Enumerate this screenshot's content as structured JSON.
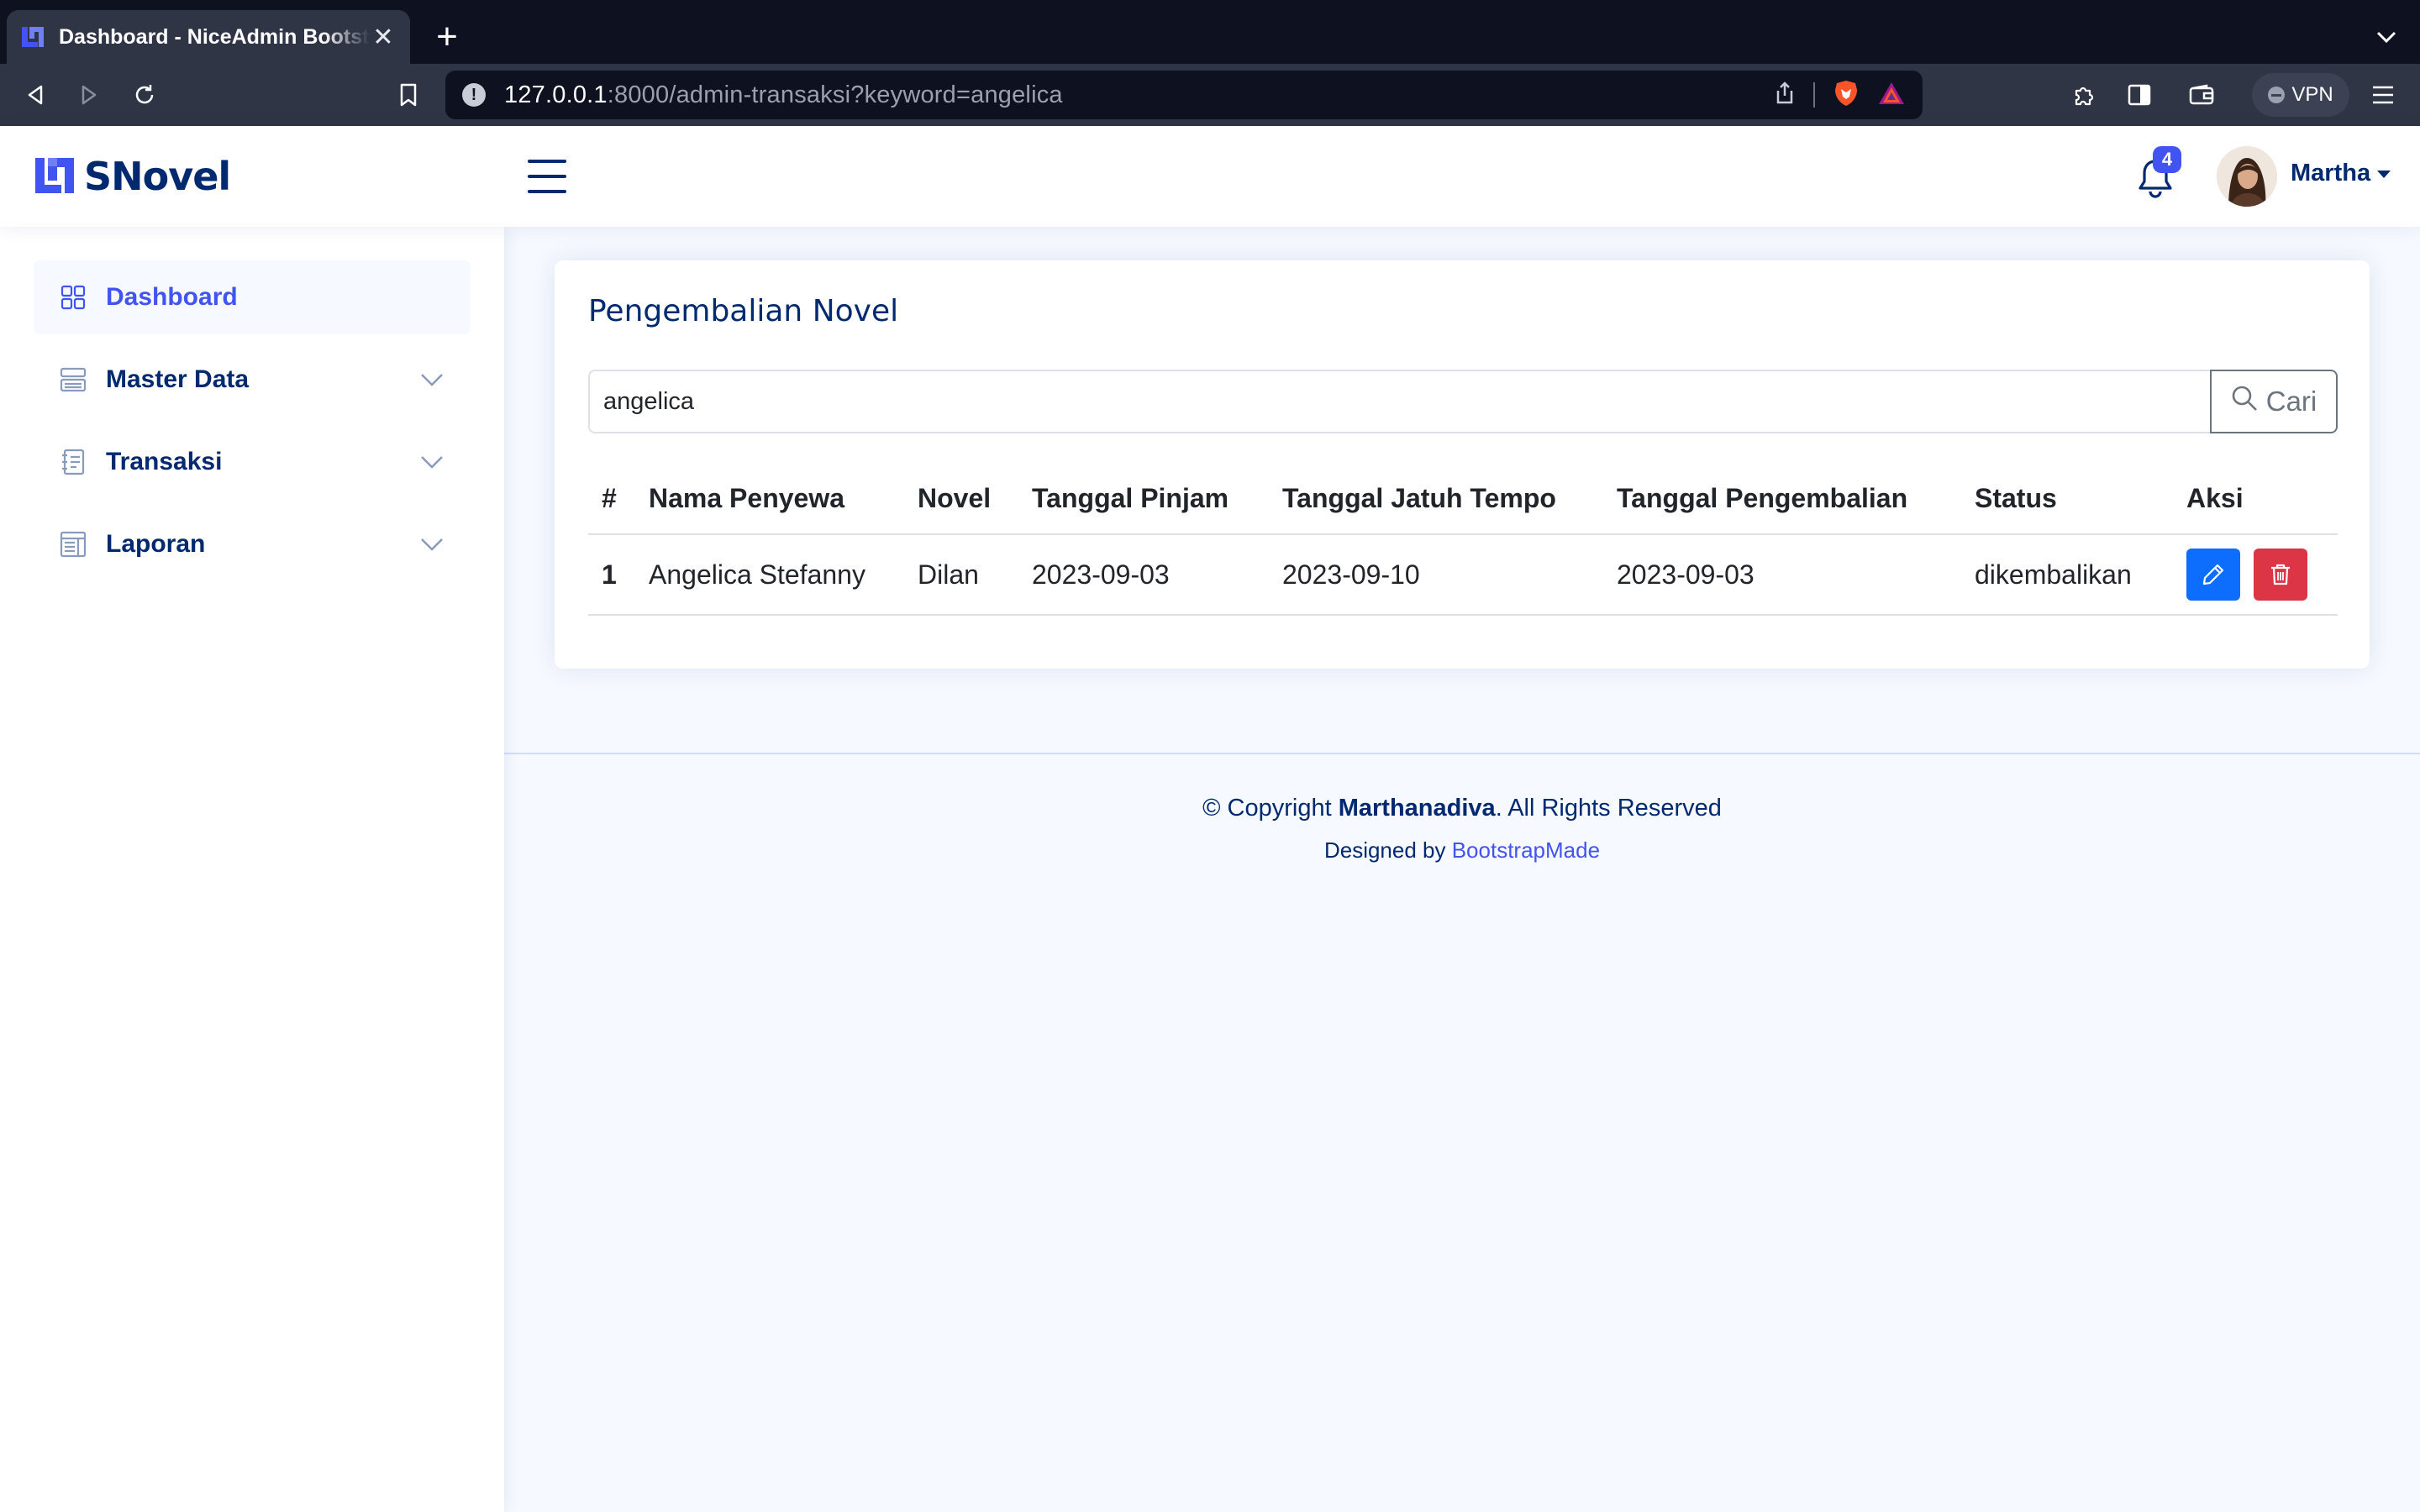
{
  "browser": {
    "tab_title": "Dashboard - NiceAdmin Bootstrap Template",
    "url_host": "127.0.0.1",
    "url_rest": ":8000/admin-transaksi?keyword=angelica",
    "vpn_label": "VPN"
  },
  "header": {
    "brand": "SNovel",
    "notification_count": "4",
    "user_name": "Martha",
    "accent_color": "#4154f1",
    "text_color": "#012970"
  },
  "sidebar": {
    "items": [
      {
        "label": "Dashboard",
        "icon": "grid-icon",
        "active": true
      },
      {
        "label": "Master Data",
        "icon": "menu-button-icon",
        "active": false
      },
      {
        "label": "Transaksi",
        "icon": "journal-text-icon",
        "active": false
      },
      {
        "label": "Laporan",
        "icon": "layout-text-window-icon",
        "active": false
      }
    ]
  },
  "main": {
    "title": "Pengembalian Novel",
    "search": {
      "value": "angelica",
      "button_label": "Cari"
    },
    "table": {
      "headers": [
        "#",
        "Nama Penyewa",
        "Novel",
        "Tanggal Pinjam",
        "Tanggal Jatuh Tempo",
        "Tanggal Pengembalian",
        "Status",
        "Aksi"
      ],
      "rows": [
        [
          "1",
          "Angelica Stefanny",
          "Dilan",
          "2023-09-03",
          "2023-09-10",
          "2023-09-03",
          "dikembalikan"
        ]
      ]
    }
  },
  "footer": {
    "copyright_prefix": "© Copyright ",
    "copyright_owner": "Marthanadiva",
    "copyright_suffix": ". All Rights Reserved",
    "designed_by": "Designed by ",
    "designer": "BootstrapMade"
  }
}
